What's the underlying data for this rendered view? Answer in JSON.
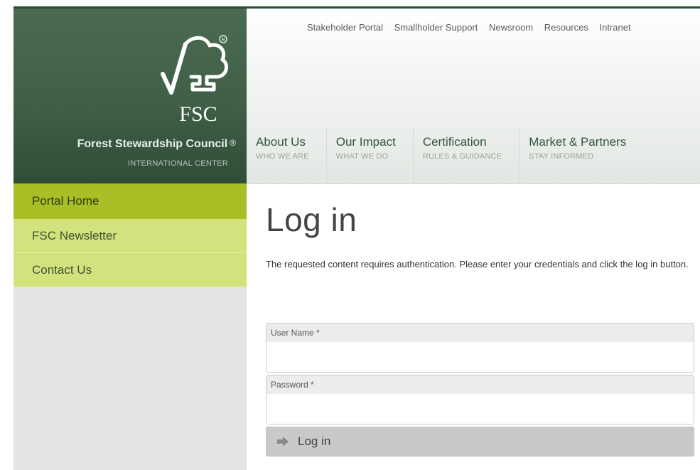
{
  "brand": {
    "logo_text": "FSC",
    "org_name": "Forest Stewardship Council",
    "registered_mark": "®",
    "org_subtitle": "INTERNATIONAL CENTER"
  },
  "utility_nav": [
    "Stakeholder Portal",
    "Smallholder Support",
    "Newsroom",
    "Resources",
    "Intranet"
  ],
  "main_nav": [
    {
      "title": "About Us",
      "sub": "WHO WE ARE"
    },
    {
      "title": "Our Impact",
      "sub": "WHAT WE DO"
    },
    {
      "title": "Certification",
      "sub": "RULES & GUIDANCE"
    },
    {
      "title": "Market & Partners",
      "sub": "STAY INFORMED"
    }
  ],
  "sidebar": {
    "items": [
      {
        "label": "Portal Home",
        "active": true
      },
      {
        "label": "FSC Newsletter",
        "active": false
      },
      {
        "label": "Contact Us",
        "active": false
      }
    ]
  },
  "content": {
    "title": "Log in",
    "intro": "The requested content requires authentication. Please enter your credentials and click the log in button."
  },
  "form": {
    "username_label": "User Name *",
    "username_value": "",
    "password_label": "Password *",
    "password_value": "",
    "submit_label": "Log in"
  },
  "colors": {
    "brand_dark_green": "#3f5f47",
    "nav_active_green": "#a9bf25",
    "nav_light_green": "#d3e27c"
  }
}
